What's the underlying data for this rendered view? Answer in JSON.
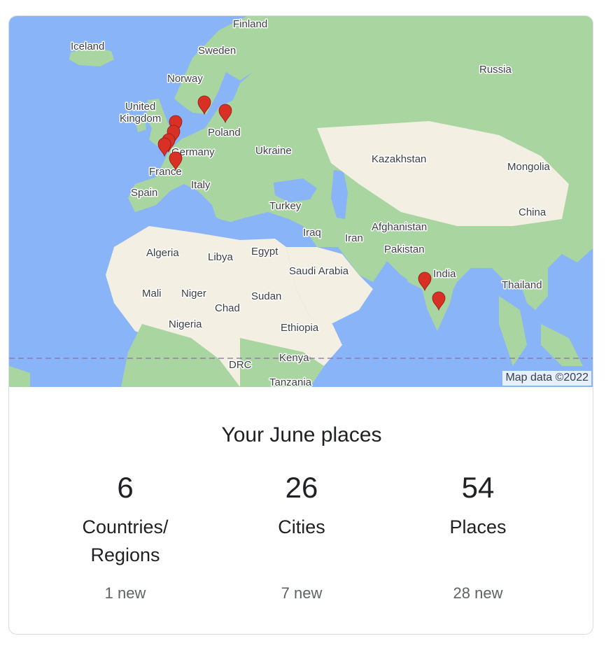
{
  "map": {
    "attribution": "Map data ©2022",
    "colors": {
      "water": "#8ab4f8",
      "land": "#a8d5a0",
      "desert": "#f3efe3",
      "marker": "#d93025"
    },
    "labels": [
      {
        "id": "iceland",
        "text": "Iceland"
      },
      {
        "id": "finland",
        "text": "Finland"
      },
      {
        "id": "sweden",
        "text": "Sweden"
      },
      {
        "id": "norway",
        "text": "Norway"
      },
      {
        "id": "russia",
        "text": "Russia"
      },
      {
        "id": "united",
        "text": "United"
      },
      {
        "id": "kingdom",
        "text": "Kingdom"
      },
      {
        "id": "poland",
        "text": "Poland"
      },
      {
        "id": "germany",
        "text": "Germany"
      },
      {
        "id": "ukraine",
        "text": "Ukraine"
      },
      {
        "id": "kazakhstan",
        "text": "Kazakhstan"
      },
      {
        "id": "mongolia",
        "text": "Mongolia"
      },
      {
        "id": "france",
        "text": "France"
      },
      {
        "id": "italy",
        "text": "Italy"
      },
      {
        "id": "spain",
        "text": "Spain"
      },
      {
        "id": "turkey",
        "text": "Turkey"
      },
      {
        "id": "china",
        "text": "China"
      },
      {
        "id": "iraq",
        "text": "Iraq"
      },
      {
        "id": "iran",
        "text": "Iran"
      },
      {
        "id": "afghanistan",
        "text": "Afghanistan"
      },
      {
        "id": "algeria",
        "text": "Algeria"
      },
      {
        "id": "libya",
        "text": "Libya"
      },
      {
        "id": "egypt",
        "text": "Egypt"
      },
      {
        "id": "pakistan",
        "text": "Pakistan"
      },
      {
        "id": "india",
        "text": "India"
      },
      {
        "id": "saudi",
        "text": "Saudi Arabia"
      },
      {
        "id": "thailand",
        "text": "Thailand"
      },
      {
        "id": "mali",
        "text": "Mali"
      },
      {
        "id": "niger",
        "text": "Niger"
      },
      {
        "id": "sudan",
        "text": "Sudan"
      },
      {
        "id": "chad",
        "text": "Chad"
      },
      {
        "id": "nigeria",
        "text": "Nigeria"
      },
      {
        "id": "ethiopia",
        "text": "Ethiopia"
      },
      {
        "id": "drc",
        "text": "DRC"
      },
      {
        "id": "kenya",
        "text": "Kenya"
      },
      {
        "id": "tanzania",
        "text": "Tanzania"
      }
    ],
    "marker_icon": "map-pin-icon",
    "marker_count": 9
  },
  "summary": {
    "title": "Your June places",
    "stats": [
      {
        "number": "6",
        "label_line1": "Countries/",
        "label_line2": "Regions",
        "new": "1 new"
      },
      {
        "number": "26",
        "label_line1": "Cities",
        "label_line2": "",
        "new": "7 new"
      },
      {
        "number": "54",
        "label_line1": "Places",
        "label_line2": "",
        "new": "28 new"
      }
    ]
  }
}
